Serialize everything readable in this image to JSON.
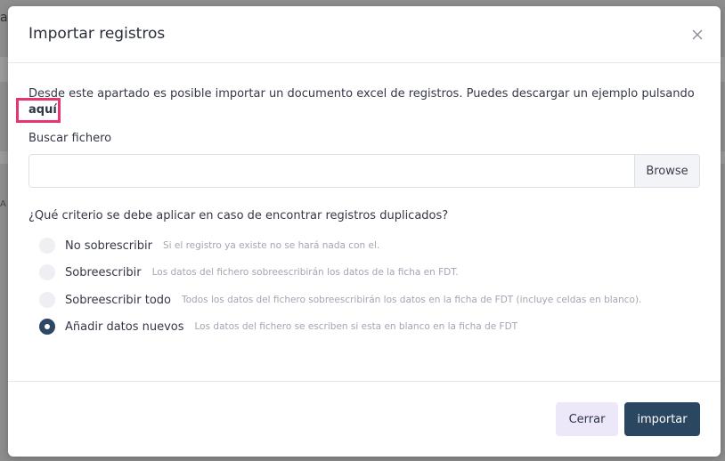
{
  "background": {
    "edge_text_top": "a",
    "edge_text_mid": "A"
  },
  "modal": {
    "title": "Importar registros",
    "description": "Desde este apartado es posible importar un documento excel de registros. Puedes descargar un ejemplo pulsando",
    "link_label": "aquí",
    "file_label": "Buscar fichero",
    "file_value": "",
    "browse_label": "Browse",
    "question": "¿Qué criterio se debe aplicar en caso de encontrar registros duplicados?",
    "options": [
      {
        "label": "No sobrescribir",
        "hint": "Si el registro ya existe no se hará nada con el.",
        "checked": false
      },
      {
        "label": "Sobreescribir",
        "hint": "Los datos del fichero sobreescribirán los datos de la ficha en FDT.",
        "checked": false
      },
      {
        "label": "Sobreescribir todo",
        "hint": "Todos los datos del fichero sobreescribirán los datos en la ficha de FDT (incluye celdas en blanco).",
        "checked": false
      },
      {
        "label": "Añadir datos nuevos",
        "hint": "Los datos del fichero se escriben si esta en blanco en la ficha de FDT",
        "checked": true
      }
    ],
    "cancel_label": "Cerrar",
    "submit_label": "importar"
  },
  "colors": {
    "primary": "#2a4661",
    "secondary_button": "#ece8fa",
    "highlight_border": "#e8356d"
  }
}
